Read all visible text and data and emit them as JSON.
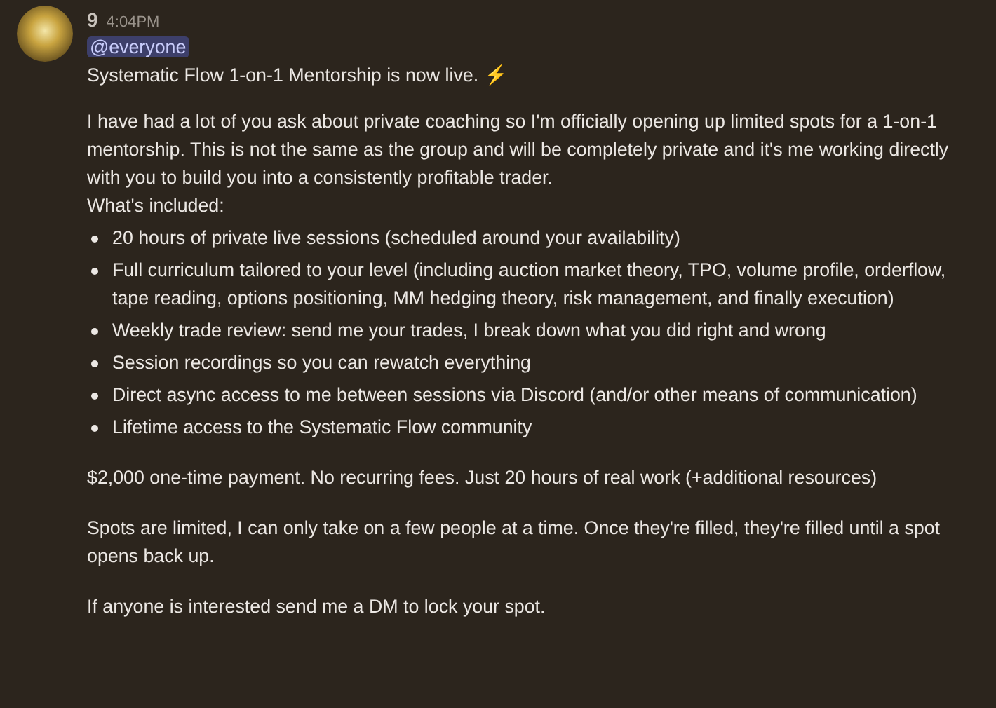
{
  "message": {
    "author": "9",
    "timestamp": "4:04PM",
    "mention": "@everyone",
    "paragraphs_before": [
      "Systematic Flow 1-on-1 Mentorship is now live. ⚡",
      "I have had a lot of you ask about private coaching so I'm officially opening up limited spots for a 1-on-1 mentorship. This is not the same as the group and will be completely private and it's me working directly with you to build you into a consistently profitable trader."
    ],
    "list_heading": "What's included:",
    "list_items": [
      "20 hours of private live sessions (scheduled around your availability)",
      "Full curriculum tailored to your level (including auction market theory, TPO, volume profile, orderflow, tape reading, options positioning, MM hedging theory, risk management, and finally execution)",
      "Weekly trade review: send me your trades, I break down what you did right and wrong",
      "Session recordings so you can rewatch everything",
      "Direct async access to me between sessions via Discord (and/or other means of communication)",
      "Lifetime access to the Systematic Flow community"
    ],
    "paragraphs_after": [
      "$2,000 one-time payment. No recurring fees. Just 20 hours of real work (+additional resources)",
      "Spots are limited, I can only take on a few people at a time. Once they're filled, they're filled until a spot opens back up.",
      "If anyone is interested send me a DM to lock your spot."
    ]
  }
}
